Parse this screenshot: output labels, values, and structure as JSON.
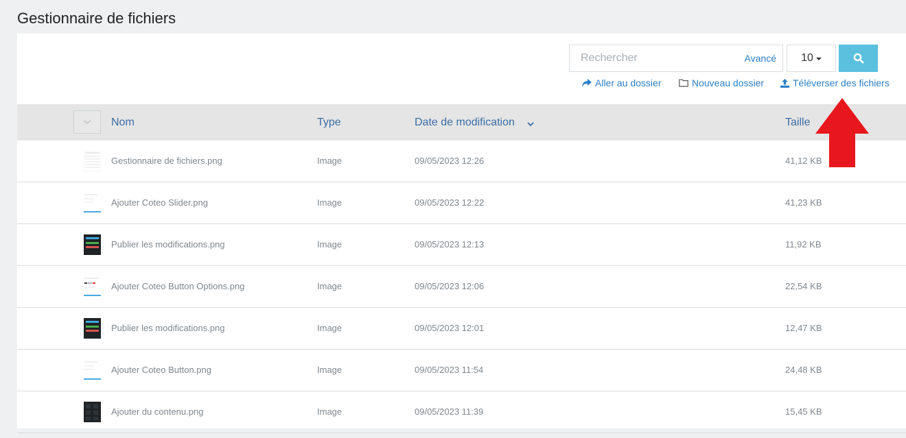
{
  "page_title": "Gestionnaire de fichiers",
  "toolbar": {
    "search_placeholder": "Rechercher",
    "advanced_label": "Avancé",
    "per_page_value": "10",
    "go_to_folder_label": "Aller au dossier",
    "new_folder_label": "Nouveau dossier",
    "upload_label": "Téléverser des fichiers"
  },
  "table": {
    "columns": {
      "name": "Nom",
      "type": "Type",
      "modified": "Date de modification",
      "size": "Taille"
    },
    "rows": [
      {
        "name": "Gestionnaire de fichiers.png",
        "type": "Image",
        "modified": "09/05/2023 12:26",
        "size": "41,12 KB",
        "thumb": "light-table"
      },
      {
        "name": "Ajouter Coteo Slider.png",
        "type": "Image",
        "modified": "09/05/2023 12:22",
        "size": "41,23 KB",
        "thumb": "light-form"
      },
      {
        "name": "Publier les modifications.png",
        "type": "Image",
        "modified": "09/05/2023 12:13",
        "size": "11,92 KB",
        "thumb": "dark-buttons"
      },
      {
        "name": "Ajouter Coteo Button Options.png",
        "type": "Image",
        "modified": "09/05/2023 12:06",
        "size": "22,54 KB",
        "thumb": "light-options"
      },
      {
        "name": "Publier les modifications.png",
        "type": "Image",
        "modified": "09/05/2023 12:01",
        "size": "12,47 KB",
        "thumb": "dark-buttons"
      },
      {
        "name": "Ajouter Coteo Button.png",
        "type": "Image",
        "modified": "09/05/2023 11:54",
        "size": "24,48 KB",
        "thumb": "light-form"
      },
      {
        "name": "Ajouter du contenu.png",
        "type": "Image",
        "modified": "09/05/2023 11:39",
        "size": "15,45 KB",
        "thumb": "dark-grid"
      }
    ]
  },
  "colors": {
    "link": "#2b7fc6",
    "header_text": "#3a6ea5",
    "search_button": "#5bc0de",
    "annotation_arrow": "#e8171d"
  },
  "icons": {
    "search_button": "search-icon",
    "go_to_folder": "share-arrow-icon",
    "new_folder": "folder-outline-icon",
    "upload": "upload-icon",
    "sort": "chevron-down-icon",
    "annotation": "red-up-arrow-icon"
  }
}
